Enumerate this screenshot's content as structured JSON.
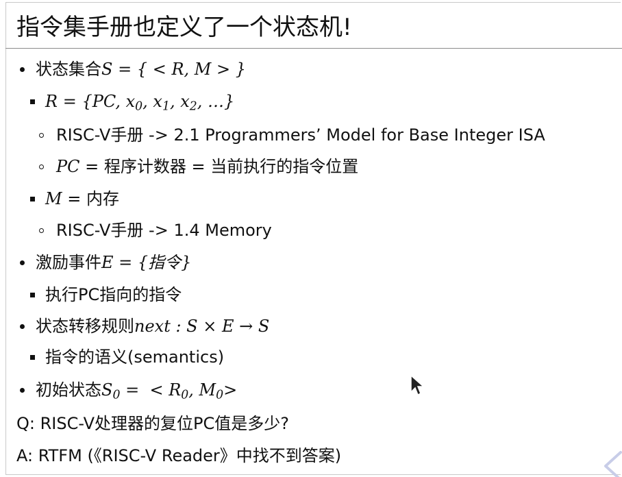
{
  "slide": {
    "title": "指令集手册也定义了一个状态机!"
  },
  "items": [
    {
      "level": 0,
      "marker": "disc",
      "pre": "状态集合",
      "math": "S = { < R, M > }"
    },
    {
      "level": 1,
      "marker": "square",
      "pre": "",
      "math": "R = {PC, x0, x1, x2, …}"
    },
    {
      "level": 2,
      "marker": "circle",
      "pre": "RISC-V手册 -> 2.1 Programmers’ Model for Base Integer ISA",
      "math": ""
    },
    {
      "level": 2,
      "marker": "circle",
      "pre": "",
      "math": "PC",
      "post": " = 程序计数器 = 当前执行的指令位置"
    },
    {
      "level": 1,
      "marker": "square",
      "pre": "",
      "math": "M",
      "post": " = 内存"
    },
    {
      "level": 2,
      "marker": "circle",
      "pre": "RISC-V手册 -> 1.4 Memory",
      "math": ""
    },
    {
      "level": 0,
      "marker": "disc",
      "pre": "激励事件",
      "math": "E = {指令}"
    },
    {
      "level": 1,
      "marker": "square",
      "pre": "执行PC指向的指令",
      "math": ""
    },
    {
      "level": 0,
      "marker": "disc",
      "pre": "状态转移规则",
      "math": "next : S × E → S"
    },
    {
      "level": 1,
      "marker": "square",
      "pre": "指令的语义(semantics)",
      "math": ""
    },
    {
      "level": 0,
      "marker": "disc",
      "pre": "初始状态",
      "math": "S0 =  < R0, M0>"
    }
  ],
  "qa": {
    "question": "Q: RISC-V处理器的复位PC值是多少?",
    "answer": "A: RTFM (《RISC-V Reader》中找不到答案)"
  },
  "icons": {
    "cursor": "mouse-pointer-icon",
    "nav": "chevron-left-icon"
  }
}
